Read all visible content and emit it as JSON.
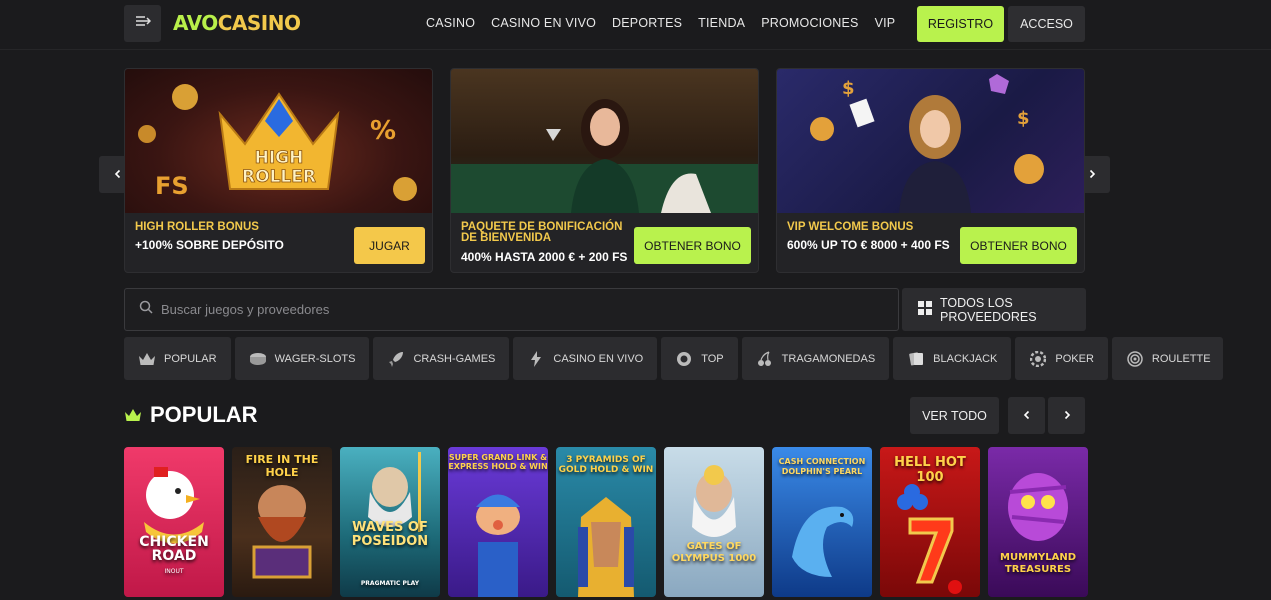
{
  "header": {
    "logo_part1": "AVO",
    "logo_part2": "CASINO",
    "nav": [
      "CASINO",
      "CASINO EN VIVO",
      "DEPORTES",
      "TIENDA",
      "PROMOCIONES",
      "VIP"
    ],
    "register_label": "REGISTRO",
    "login_label": "ACCESO"
  },
  "promos": [
    {
      "title": "HIGH ROLLER BONUS",
      "subtitle": "+100% SOBRE DEPÓSITO",
      "cta": "JUGAR",
      "cta_color": "#f4c84a",
      "art_text": "HIGH ROLLER"
    },
    {
      "title": "PAQUETE DE BONIFICACIÓN DE BIENVENIDA",
      "subtitle": "400% HASTA 2000 € + 200 FS",
      "cta": "OBTENER BONO",
      "cta_color": "#b9f24d"
    },
    {
      "title": "VIP WELCOME BONUS",
      "subtitle": "600% UP TO € 8000 + 400 FS",
      "cta": "OBTENER BONO",
      "cta_color": "#b9f24d"
    }
  ],
  "search": {
    "placeholder": "Buscar juegos y proveedores",
    "providers_label": "TODOS LOS PROVEEDORES"
  },
  "categories": [
    {
      "label": "POPULAR",
      "icon": "crown-icon"
    },
    {
      "label": "WAGER-SLOTS",
      "icon": "coins-icon"
    },
    {
      "label": "CRASH-GAMES",
      "icon": "rocket-icon"
    },
    {
      "label": "CASINO EN VIVO",
      "icon": "lightning-icon"
    },
    {
      "label": "TOP",
      "icon": "badge-icon"
    },
    {
      "label": "TRAGAMONEDAS",
      "icon": "cherries-icon"
    },
    {
      "label": "BLACKJACK",
      "icon": "cards-icon"
    },
    {
      "label": "POKER",
      "icon": "chip-icon"
    },
    {
      "label": "ROULETTE",
      "icon": "roulette-icon"
    }
  ],
  "popular": {
    "title": "POPULAR",
    "view_all": "VER TODO"
  },
  "games": [
    {
      "title": "CHICKEN ROAD",
      "provider": "INOUT",
      "bg": "#d9245a"
    },
    {
      "title": "FIRE IN THE HOLE",
      "bg": "#3a2a1c"
    },
    {
      "title": "WAVES OF POSEIDON",
      "provider": "PRAGMATIC PLAY",
      "bg": "#2b6e78"
    },
    {
      "title": "SUPER GRAND LINK & EXPRESS HOLD & WIN",
      "bg": "#4a2ba0"
    },
    {
      "title": "3 PYRAMIDS OF GOLD HOLD & WIN",
      "bg": "#1e5f74"
    },
    {
      "title": "GATES OF OLYMPUS 1000",
      "bg": "#9fb8c8"
    },
    {
      "title": "CASH CONNECTION DOLPHIN'S PEARL",
      "bg": "#1b5fb5"
    },
    {
      "title": "HELL HOT 100",
      "bg": "#b11616"
    },
    {
      "title": "MUMMYLAND TREASURES",
      "bg": "#5a1a78"
    }
  ]
}
